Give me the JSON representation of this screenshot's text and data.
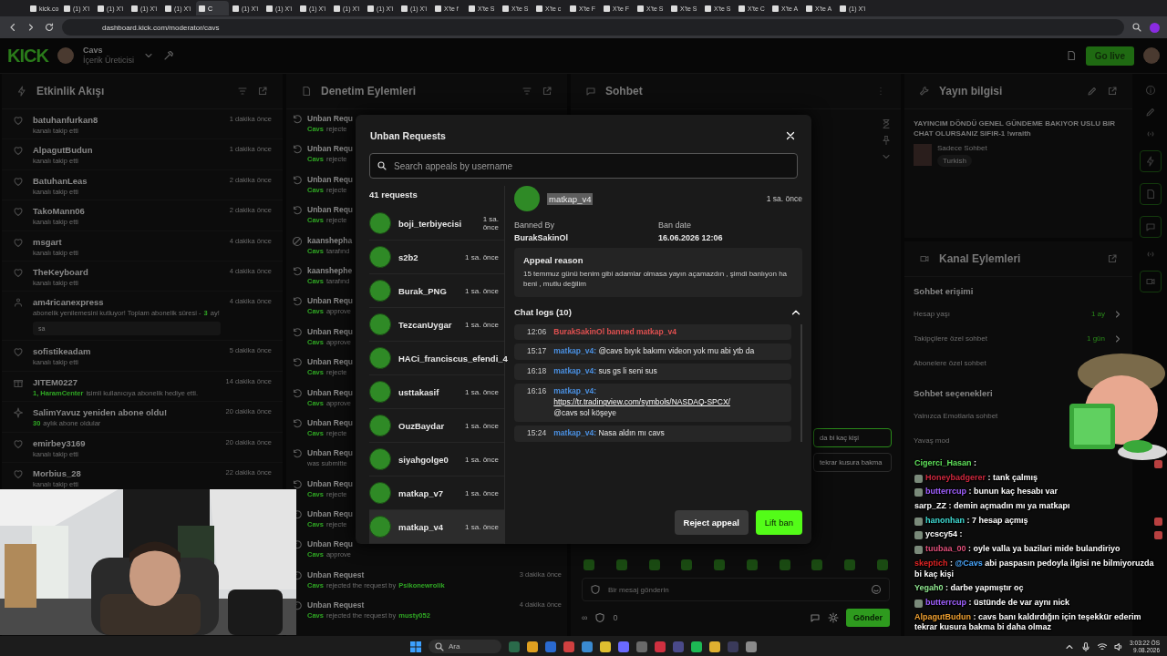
{
  "browser": {
    "tabs": [
      {
        "title": "kick.co",
        "selected": false
      },
      {
        "title": "(1) X'i",
        "selected": false
      },
      {
        "title": "(1) X'i",
        "selected": false
      },
      {
        "title": "(1) X'i",
        "selected": false
      },
      {
        "title": "(1) X'i",
        "selected": false
      },
      {
        "title": "C",
        "selected": true
      },
      {
        "title": "(1) X'i",
        "selected": false
      },
      {
        "title": "(1) X'i",
        "selected": false
      },
      {
        "title": "(1) X'i",
        "selected": false
      },
      {
        "title": "(1) X'i",
        "selected": false
      },
      {
        "title": "(1) X'i",
        "selected": false
      },
      {
        "title": "(1) X'i",
        "selected": false
      },
      {
        "title": "X'te f",
        "selected": false
      },
      {
        "title": "X'te S",
        "selected": false
      },
      {
        "title": "X'te S",
        "selected": false
      },
      {
        "title": "X'te c",
        "selected": false
      },
      {
        "title": "X'te F",
        "selected": false
      },
      {
        "title": "X'te F",
        "selected": false
      },
      {
        "title": "X'te S",
        "selected": false
      },
      {
        "title": "X'te S",
        "selected": false
      },
      {
        "title": "X'te S",
        "selected": false
      },
      {
        "title": "X'te C",
        "selected": false
      },
      {
        "title": "X'te A",
        "selected": false
      },
      {
        "title": "X'te A",
        "selected": false
      },
      {
        "title": "(1) X'i",
        "selected": false
      }
    ],
    "url": "dashboard.kick.com/moderator/cavs"
  },
  "header": {
    "logo": "KICK",
    "channel": "Cavs",
    "role": "İçerik Üreticisi",
    "go_live": "Go live"
  },
  "activity": {
    "title": "Etkinlik Akışı",
    "items": [
      {
        "kind": "follow",
        "name": "batuhanfurkan8",
        "detail": [
          {
            "text": "kanalı takip etti",
            "highlight": false
          }
        ],
        "time": "1 dakika önce"
      },
      {
        "kind": "follow",
        "name": "AlpagutBudun",
        "detail": [
          {
            "text": "kanalı takip etti",
            "highlight": false
          }
        ],
        "time": "1 dakika önce"
      },
      {
        "kind": "follow",
        "name": "BatuhanLeas",
        "detail": [
          {
            "text": "kanalı takip etti",
            "highlight": false
          }
        ],
        "time": "2 dakika önce"
      },
      {
        "kind": "follow",
        "name": "TakoMann06",
        "detail": [
          {
            "text": "kanalı takip etti",
            "highlight": false
          }
        ],
        "time": "2 dakika önce"
      },
      {
        "kind": "follow",
        "name": "msgart",
        "detail": [
          {
            "text": "kanalı takip etti",
            "highlight": false
          }
        ],
        "time": "4 dakika önce"
      },
      {
        "kind": "follow",
        "name": "TheKeyboard",
        "detail": [
          {
            "text": "kanalı takip etti",
            "highlight": false
          }
        ],
        "time": "4 dakika önce"
      },
      {
        "kind": "sub",
        "name": "am4ricanexpress",
        "detail": [
          {
            "text": "abonelik yenilemesini kutluyor! Toplam abonelik süresi -",
            "highlight": false
          },
          {
            "text": "3",
            "highlight": true
          },
          {
            "text": "ay!",
            "highlight": false
          }
        ],
        "quote": "sa",
        "time": "4 dakika önce"
      },
      {
        "kind": "follow",
        "name": "sofistikeadam",
        "detail": [
          {
            "text": "kanalı takip etti",
            "highlight": false
          }
        ],
        "time": "5 dakika önce"
      },
      {
        "kind": "gift",
        "name": "JITEM0227",
        "detail": [
          {
            "text": "1, HaramCenter",
            "highlight": true
          },
          {
            "text": "isimli kullanıcıya abonelik hediye etti.",
            "highlight": false
          }
        ],
        "time": "14 dakika önce"
      },
      {
        "kind": "resub",
        "name": "SalimYavuz yeniden abone oldu!",
        "detail": [
          {
            "text": "30",
            "highlight": true
          },
          {
            "text": "aylık abone oldular",
            "highlight": false
          }
        ],
        "time": "20 dakika önce"
      },
      {
        "kind": "follow",
        "name": "emirbey3169",
        "detail": [
          {
            "text": "kanalı takip etti",
            "highlight": false
          }
        ],
        "time": "20 dakika önce"
      },
      {
        "kind": "follow",
        "name": "Morbius_28",
        "detail": [
          {
            "text": "kanalı takip etti",
            "highlight": false
          }
        ],
        "time": "22 dakika önce"
      }
    ]
  },
  "moderation": {
    "title": "Denetim Eylemleri",
    "items": [
      {
        "kind": "unban",
        "title": "Unban Requ",
        "actor": "Cavs",
        "detail": "rejecte"
      },
      {
        "kind": "unban",
        "title": "Unban Requ",
        "actor": "Cavs",
        "detail": "rejecte"
      },
      {
        "kind": "unban",
        "title": "Unban Requ",
        "actor": "Cavs",
        "detail": "rejecte"
      },
      {
        "kind": "unban",
        "title": "Unban Requ",
        "actor": "Cavs",
        "detail": "rejecte"
      },
      {
        "kind": "ban",
        "title": "kaanshepha",
        "actor": "Cavs",
        "detail": "tarafınd"
      },
      {
        "kind": "unban",
        "title": "kaanshephe",
        "actor": "Cavs",
        "detail": "tarafınd"
      },
      {
        "kind": "unban",
        "title": "Unban Requ",
        "actor": "Cavs",
        "detail": "approve"
      },
      {
        "kind": "unban",
        "title": "Unban Requ",
        "actor": "Cavs",
        "detail": "approve"
      },
      {
        "kind": "unban",
        "title": "Unban Requ",
        "actor": "Cavs",
        "detail": "rejecte"
      },
      {
        "kind": "unban",
        "title": "Unban Requ",
        "actor": "Cavs",
        "detail": "approve"
      },
      {
        "kind": "unban",
        "title": "Unban Requ",
        "actor": "Cavs",
        "detail": "rejecte"
      },
      {
        "kind": "unban",
        "title": "Unban Requ",
        "detail": "was submitte"
      },
      {
        "kind": "unban",
        "title": "Unban Requ",
        "actor": "Cavs",
        "detail": "rejecte"
      },
      {
        "kind": "unban",
        "title": "Unban Requ",
        "actor": "Cavs",
        "detail": "rejecte"
      },
      {
        "kind": "unban",
        "title": "Unban Requ",
        "actor": "Cavs",
        "detail": "approve"
      },
      {
        "kind": "unban",
        "title": "Unban Request",
        "actor": "Cavs",
        "detail": "rejected the request by",
        "target": "Psikonewrolik",
        "time": "3 dakika önce"
      },
      {
        "kind": "unban",
        "title": "Unban Request",
        "actor": "Cavs",
        "detail": "rejected the request by",
        "target": "musty052",
        "time": "4 dakika önce"
      }
    ]
  },
  "chat_panel": {
    "title": "Sohbet",
    "messages": [
      {
        "text": "da bi kaç kişi",
        "highlighted": true
      },
      {
        "text": "tekrar kusura bakma",
        "highlighted": false
      }
    ],
    "placeholder": "Bir mesaj gönderin",
    "slow": "∞",
    "count": "0",
    "send": "Gönder"
  },
  "stream_info": {
    "title": "Yayın bilgisi",
    "stream_title": "YAYINCIM DÖNDÜ GENEL GÜNDEME BAKIYOR USLU BIR CHAT OLURSANIZ SIFIR-1 !wraith",
    "category": "Sadece Sohbet",
    "tags": [
      "Turkish"
    ]
  },
  "channel_actions": {
    "title": "Kanal Eylemleri",
    "sections": [
      {
        "heading": "Sohbet erişimi",
        "rows": [
          {
            "label": "Hesap yaşı",
            "value": "1 ay"
          },
          {
            "label": "Takipçilere özel sohbet",
            "value": "1 gün"
          },
          {
            "label": "Abonelere özel sohbet"
          }
        ]
      },
      {
        "heading": "Sohbet seçenekleri",
        "rows": [
          {
            "label": "Yalnızca Emotlarla sohbet"
          },
          {
            "label": "Yavaş mod"
          }
        ]
      }
    ]
  },
  "modal": {
    "title": "Unban Requests",
    "search_placeholder": "Search appeals by username",
    "count": "41 requests",
    "requests": [
      {
        "name": "boji_terbiyecisi",
        "time": "1 sa. önce",
        "selected": false
      },
      {
        "name": "s2b2",
        "time": "1 sa. önce",
        "selected": false
      },
      {
        "name": "Burak_PNG",
        "time": "1 sa. önce",
        "selected": false
      },
      {
        "name": "TezcanUygar",
        "time": "1 sa. önce",
        "selected": false
      },
      {
        "name": "HACi_franciscus_efendi_4",
        "selected": false
      },
      {
        "name": "usttakasif",
        "time": "1 sa. önce",
        "selected": false
      },
      {
        "name": "OuzBaydar",
        "time": "1 sa. önce",
        "selected": false
      },
      {
        "name": "siyahgolge0",
        "time": "1 sa. önce",
        "selected": false
      },
      {
        "name": "matkap_v7",
        "time": "1 sa. önce",
        "selected": false
      },
      {
        "name": "matkap_v4",
        "time": "1 sa. önce",
        "selected": true
      }
    ],
    "detail": {
      "name": "matkap_v4",
      "name_selected": true,
      "time": "1 sa. önce",
      "banned_by_label": "Banned By",
      "banned_by": "BurakSakinOl",
      "ban_date_label": "Ban date",
      "ban_date": "16.06.2026 12:06",
      "reason_label": "Appeal reason",
      "reason": "15 temmuz günü benim gibi adamlar olmasa yayın açamazdın , şimdi banlıyon ha beni , mutlu değilim",
      "logs_label": "Chat logs (10)",
      "logs_expanded": true,
      "logs": [
        {
          "kind": "ban",
          "time": "12:06",
          "text": "BurakSakinOl banned matkap_v4"
        },
        {
          "kind": "message",
          "time": "15:17",
          "user": "matkap_v4:",
          "text": "@cavs bıyık bakımı videon yok mu abi ytb da"
        },
        {
          "kind": "message",
          "time": "16:18",
          "user": "matkap_v4:",
          "text": "sus gs li seni sus"
        },
        {
          "kind": "message",
          "time": "16:16",
          "user": "matkap_v4:",
          "link": "https://tr.tradingview.com/symbols/NASDAQ-SPCX/",
          "text": "@cavs sol köşeye"
        },
        {
          "kind": "message",
          "time": "15:24",
          "user": "matkap_v4:",
          "text": "Nasa aldın mı cavs"
        }
      ]
    },
    "reject": "Reject appeal",
    "lift": "Lift ban"
  },
  "overlay_chat": [
    {
      "user": "Cigerci_Hasan",
      "color": "#5fe05a",
      "badge": false,
      "message": ":",
      "emote": true
    },
    {
      "user": "Honeybadgerer",
      "color": "#d0283e",
      "badge": true,
      "message": ": tank çalmış",
      "emote": false
    },
    {
      "user": "butterrcup",
      "color": "#a060ff",
      "badge": true,
      "message": ": bunun kaç hesabı var",
      "emote": false
    },
    {
      "user": "sarp_ZZ",
      "color": "#ffffff",
      "badge": false,
      "message": ": demin açmadın mı ya matkapı",
      "emote": false
    },
    {
      "user": "hanonhan",
      "color": "#40dcd4",
      "badge": true,
      "message": ": 7 hesap açmış",
      "emote": true
    },
    {
      "user": "ycscy54",
      "color": "#ffffff",
      "badge": true,
      "message": ":",
      "emote": true
    },
    {
      "user": "tuubaa_00",
      "color": "#e0507a",
      "badge": true,
      "message": ": oyle valla ya bazilari mide bulandiriyo",
      "emote": false
    },
    {
      "user": "skeptich",
      "color": "#e02424",
      "badge": false,
      "message": ":",
      "mention": "@Cavs",
      "after": "abi paspasın pedoyla ilgisi ne bilmiyoruzda bi kaç kişi",
      "emote": false
    },
    {
      "user": "Yegah0",
      "color": "#90e890",
      "badge": false,
      "message": ": darbe yapmıştır oç",
      "emote": false
    },
    {
      "user": "butterrcup",
      "color": "#a060ff",
      "badge": true,
      "message": ": üstünde de var aynı nick",
      "emote": false
    },
    {
      "user": "AlpagutBudun",
      "color": "#f0a030",
      "badge": false,
      "message": ": cavs banı kaldırdığın için teşekkür ederim tekrar kusura bakma bi daha olmaz",
      "emote": false
    }
  ],
  "taskbar": {
    "search": "Ara",
    "time": "3:03:22 ÖS",
    "date": "9.08.2026"
  }
}
